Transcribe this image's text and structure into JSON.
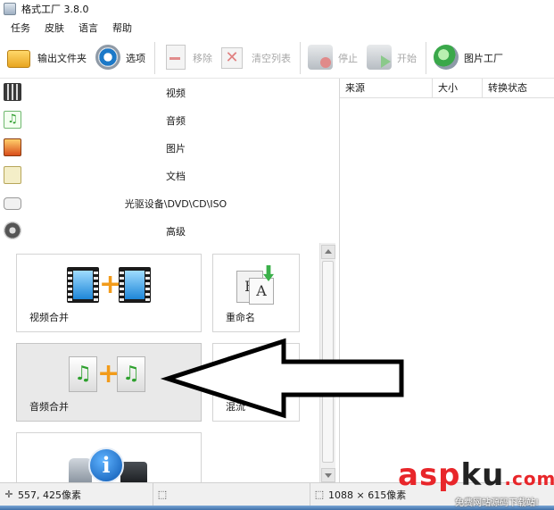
{
  "window": {
    "title": "格式工厂 3.8.0"
  },
  "menu": [
    "任务",
    "皮肤",
    "语言",
    "帮助"
  ],
  "toolbar": {
    "output_folder": "输出文件夹",
    "options": "选项",
    "remove": "移除",
    "clear_list": "清空列表",
    "stop": "停止",
    "start": "开始",
    "picture_factory": "图片工厂"
  },
  "categories": [
    {
      "label": "视频",
      "icon": "video-icon"
    },
    {
      "label": "音频",
      "icon": "audio-icon"
    },
    {
      "label": "图片",
      "icon": "image-icon"
    },
    {
      "label": "文档",
      "icon": "document-icon"
    },
    {
      "label": "光驱设备\\DVD\\CD\\ISO",
      "icon": "disc-drive-icon"
    },
    {
      "label": "高级",
      "icon": "advanced-icon"
    }
  ],
  "tiles": {
    "video_merge": "视频合并",
    "rename": "重命名",
    "audio_merge": "音频合并",
    "mux": "混流"
  },
  "rename_glyphs": {
    "b": "B",
    "a": "A"
  },
  "glyphs": {
    "plus": "+",
    "note": "♫",
    "info": "i"
  },
  "table": {
    "columns": [
      "来源",
      "大小",
      "转换状态"
    ]
  },
  "status": {
    "cursor_pos": "557, 425像素",
    "selection": "",
    "image_size": "1088 × 615像素"
  },
  "watermark": {
    "logo_a": "asp",
    "logo_b": "ku",
    "logo_c": ".com",
    "sub": "免费网站源码下载站!"
  },
  "colors": {
    "accent_orange": "#f29b1a",
    "arrow_black": "#000000",
    "watermark_red": "#e8262a"
  }
}
